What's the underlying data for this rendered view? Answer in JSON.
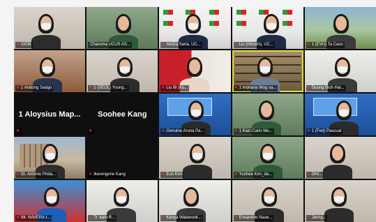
{
  "meeting": {
    "participants": [
      {
        "name": "GIOK",
        "scene": "office",
        "mic_muted": true,
        "big": false,
        "active": false
      },
      {
        "name": "Charoma UCUS AS...",
        "scene": "green-room",
        "mic_muted": false,
        "big": false,
        "active": false
      },
      {
        "name": "AmDa Saria, UC...",
        "scene": "banner",
        "mic_muted": true,
        "big": false,
        "active": false
      },
      {
        "name": "Liu (Hiroshi), UC...",
        "scene": "banner",
        "mic_muted": true,
        "big": false,
        "active": false
      },
      {
        "name": "1 (EVU) Ta Caso",
        "scene": "landscape",
        "mic_muted": true,
        "big": false,
        "active": false
      },
      {
        "name": "1 Andong Sadgo",
        "scene": "red-room",
        "mic_muted": true,
        "big": false,
        "active": false
      },
      {
        "name": "1 (SEOL) Young...",
        "scene": "office",
        "mic_muted": true,
        "big": false,
        "active": false
      },
      {
        "name": "Liu Bi (Ku...",
        "scene": "flag",
        "mic_muted": true,
        "big": false,
        "active": false
      },
      {
        "name": "1 Indriana Wog sa...",
        "scene": "bookshelf",
        "mic_muted": true,
        "big": false,
        "active": true
      },
      {
        "name": "Duong Bich Hai...",
        "scene": "light-room",
        "mic_muted": true,
        "big": false,
        "active": false
      },
      {
        "name": "1 Aloysius Map...",
        "scene": "blank",
        "mic_muted": true,
        "big": true,
        "active": false
      },
      {
        "name": "Soohee Kang",
        "scene": "blank",
        "mic_muted": true,
        "big": true,
        "active": false
      },
      {
        "name": "Genuine Aruna Pa...",
        "scene": "blue-screen",
        "mic_muted": true,
        "big": false,
        "active": false
      },
      {
        "name": "1 Kian Carlo Me...",
        "scene": "green-room",
        "mic_muted": true,
        "big": false,
        "active": false
      },
      {
        "name": "1 (Fed) Pascual",
        "scene": "blue-screen",
        "mic_muted": true,
        "big": false,
        "active": false
      },
      {
        "name": "Dr. Antonio Prida...",
        "scene": "building",
        "mic_muted": true,
        "big": false,
        "active": false
      },
      {
        "name": "Ikerengeno Kang",
        "scene": "blank",
        "mic_muted": true,
        "big": false,
        "active": false
      },
      {
        "name": "Eun Kim",
        "scene": "office",
        "mic_muted": true,
        "big": false,
        "active": false
      },
      {
        "name": "Yunhee Kim_da...",
        "scene": "green-room",
        "mic_muted": true,
        "big": false,
        "active": false
      },
      {
        "name": "DHI...",
        "scene": "office",
        "mic_muted": true,
        "big": false,
        "active": false
      },
      {
        "name": "Mr. NAVERA I...",
        "scene": "sport",
        "mic_muted": true,
        "big": false,
        "active": false
      },
      {
        "name": "Tr. kam R...",
        "scene": "light-room",
        "mic_muted": true,
        "big": false,
        "active": false
      },
      {
        "name": "Kanya Watanook...",
        "scene": "light-room",
        "mic_muted": true,
        "big": false,
        "active": false
      },
      {
        "name": "Ensamble Naue...",
        "scene": "office",
        "mic_muted": true,
        "big": false,
        "active": false
      },
      {
        "name": "Jenny...",
        "scene": "office",
        "mic_muted": true,
        "big": false,
        "active": false
      }
    ]
  },
  "colors": {
    "active_outline": "#d8dd4a",
    "mic_muted": "#e23b3b",
    "grid_background": "#0f0f0f"
  }
}
